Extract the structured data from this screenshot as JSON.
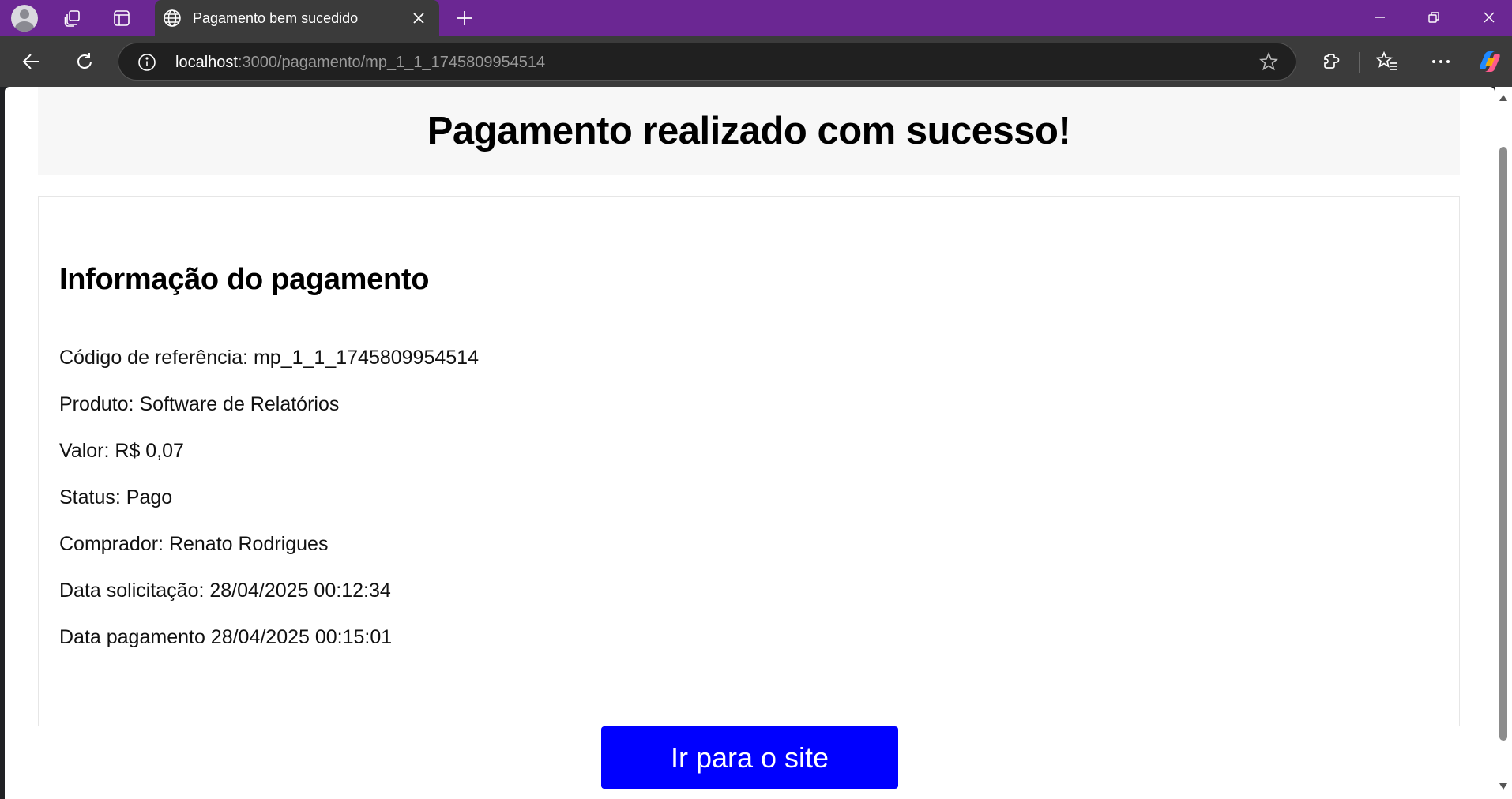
{
  "browser": {
    "tab_title": "Pagamento bem sucedido",
    "url_host": "localhost",
    "url_path": ":3000/pagamento/mp_1_1_1745809954514",
    "accent_color": "#6b2793"
  },
  "page": {
    "title": "Pagamento realizado com sucesso!",
    "section_title": "Informação do pagamento",
    "lines": [
      "Código de referência: mp_1_1_1745809954514",
      "Produto: Software de Relatórios",
      "Valor: R$ 0,07",
      "Status: Pago",
      "Comprador: Renato Rodrigues",
      "Data solicitação: 28/04/2025 00:12:34",
      "Data pagamento 28/04/2025 00:15:01"
    ],
    "button_label": "Ir para o site",
    "button_color": "#0000ff"
  }
}
